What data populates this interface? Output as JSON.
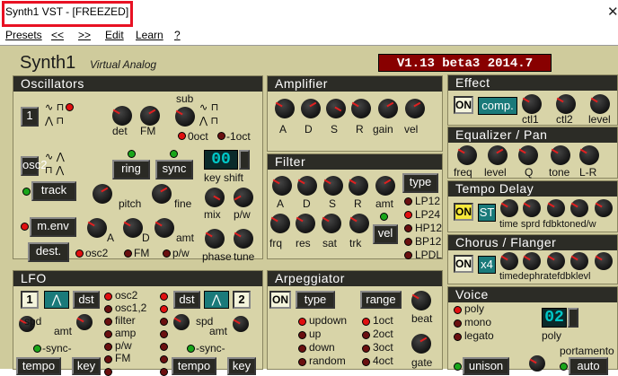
{
  "window": {
    "title": "Synth1 VST -  [FREEZED]",
    "close": "✕"
  },
  "menu": {
    "presets": "Presets",
    "prev": "<<",
    "next": ">>",
    "edit": "Edit",
    "learn": "Learn",
    "help": "?"
  },
  "header": {
    "name": "Synth1",
    "subtitle": "Virtual Analog",
    "version": "V1.13 beta3 2014.7"
  },
  "osc": {
    "title": "Oscillators",
    "osc1": "1",
    "osc2": "osc2",
    "sub": "sub",
    "det": "det",
    "fm": "FM",
    "oct0": "0oct",
    "octm1": "-1oct",
    "ring": "ring",
    "sync": "sync",
    "track": "track",
    "pitch": "pitch",
    "fine": "fine",
    "menv": "m.env",
    "dest": "dest.",
    "a": "A",
    "d": "D",
    "amt": "amt",
    "fmx": "FM",
    "pw": "p/w",
    "lcd": "00",
    "keyshift": "key shift",
    "mix": "mix",
    "pw2": "p/w",
    "phase": "phase",
    "tune": "tune"
  },
  "amp": {
    "title": "Amplifier",
    "a": "A",
    "d": "D",
    "s": "S",
    "r": "R",
    "gain": "gain",
    "vel": "vel"
  },
  "filter": {
    "title": "Filter",
    "a": "A",
    "d": "D",
    "s": "S",
    "r": "R",
    "amt": "amt",
    "type": "type",
    "frq": "frq",
    "res": "res",
    "sat": "sat",
    "trk": "trk",
    "vel": "vel",
    "types": [
      "LP12",
      "LP24",
      "HP12",
      "BP12",
      "LPDL"
    ]
  },
  "effect": {
    "title": "Effect",
    "on": "ON",
    "mode": "comp.",
    "ctl1": "ctl1",
    "ctl2": "ctl2",
    "level": "level"
  },
  "eq": {
    "title": "Equalizer / Pan",
    "freq": "freq",
    "level": "level",
    "q": "Q",
    "tone": "tone",
    "lr": "L-R"
  },
  "delay": {
    "title": "Tempo Delay",
    "on": "ON",
    "mode": "ST",
    "labels": "time sprd fdbktoned/w"
  },
  "chorus": {
    "title": "Chorus / Flanger",
    "on": "ON",
    "mode": "x4",
    "labels": "timedephratefdbklevl"
  },
  "lfo": {
    "title": "LFO",
    "n1": "1",
    "n2": "2",
    "dst": "dst",
    "targets": [
      "osc2",
      "osc1,2",
      "filter",
      "amp",
      "p/w",
      "FM",
      "pan"
    ],
    "spd": "spd",
    "amt": "amt",
    "sync": "-sync-",
    "tempo": "tempo",
    "key": "key"
  },
  "arp": {
    "title": "Arpeggiator",
    "on": "ON",
    "type": "type",
    "range": "range",
    "beat": "beat",
    "gate": "gate",
    "modes": [
      "updown",
      "up",
      "down",
      "random"
    ],
    "ranges": [
      "1oct",
      "2oct",
      "3oct",
      "4oct"
    ]
  },
  "voice": {
    "title": "Voice",
    "modes": [
      "poly",
      "mono",
      "legato"
    ],
    "lcd": "02",
    "poly": "poly",
    "portamento": "portamento",
    "unison": "unison",
    "auto": "auto"
  }
}
